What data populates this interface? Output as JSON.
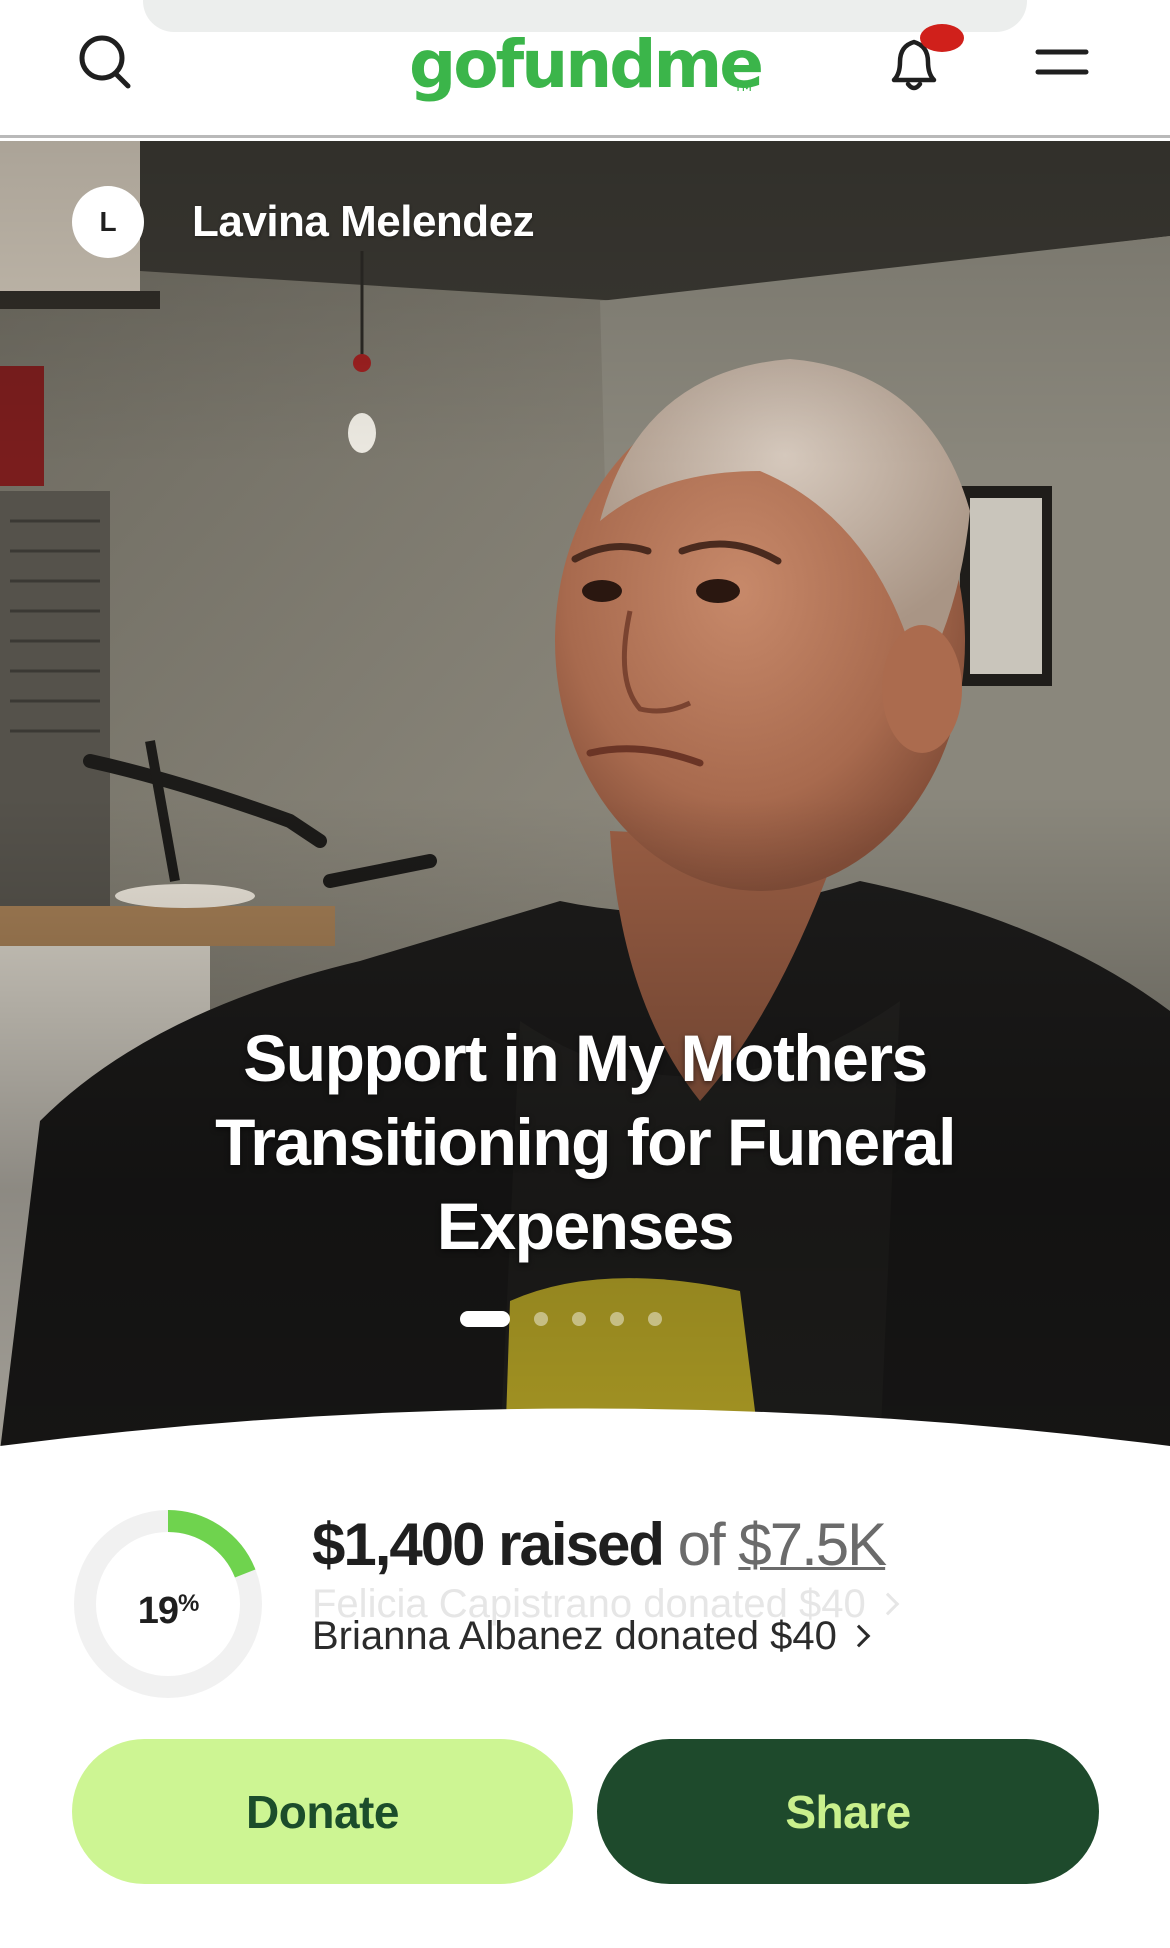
{
  "header": {
    "logo_text": "gofundme",
    "logo_tm": "TM",
    "search_icon": "search-icon",
    "bell_icon": "bell-icon",
    "menu_icon": "hamburger-menu-icon",
    "brand_color": "#3bb54a",
    "notification_badge_color": "#d0201b"
  },
  "hero": {
    "organizer": {
      "avatar_initial": "L",
      "name": "Lavina Melendez"
    },
    "title": "Support in My Mothers Transitioning for Funeral Expenses",
    "carousel": {
      "total_slides": 5,
      "active_index": 0
    },
    "photo": "woman-portrait-photo"
  },
  "progress": {
    "percent_label": "19",
    "percent_sign": "%",
    "percent_value": 0.19,
    "raised_amount": "$1,400 raised",
    "of_text": "of",
    "goal": "$7.5K",
    "ring_color": "#6fd34e",
    "ring_track_color": "#f1f1f1"
  },
  "donations_ticker": {
    "previous": "Felicia Capistrano donated $40",
    "current": "Brianna Albanez donated $40"
  },
  "actions": {
    "donate_label": "Donate",
    "share_label": "Share",
    "donate_bg": "#cdf593",
    "share_bg": "#1e4a2c"
  }
}
